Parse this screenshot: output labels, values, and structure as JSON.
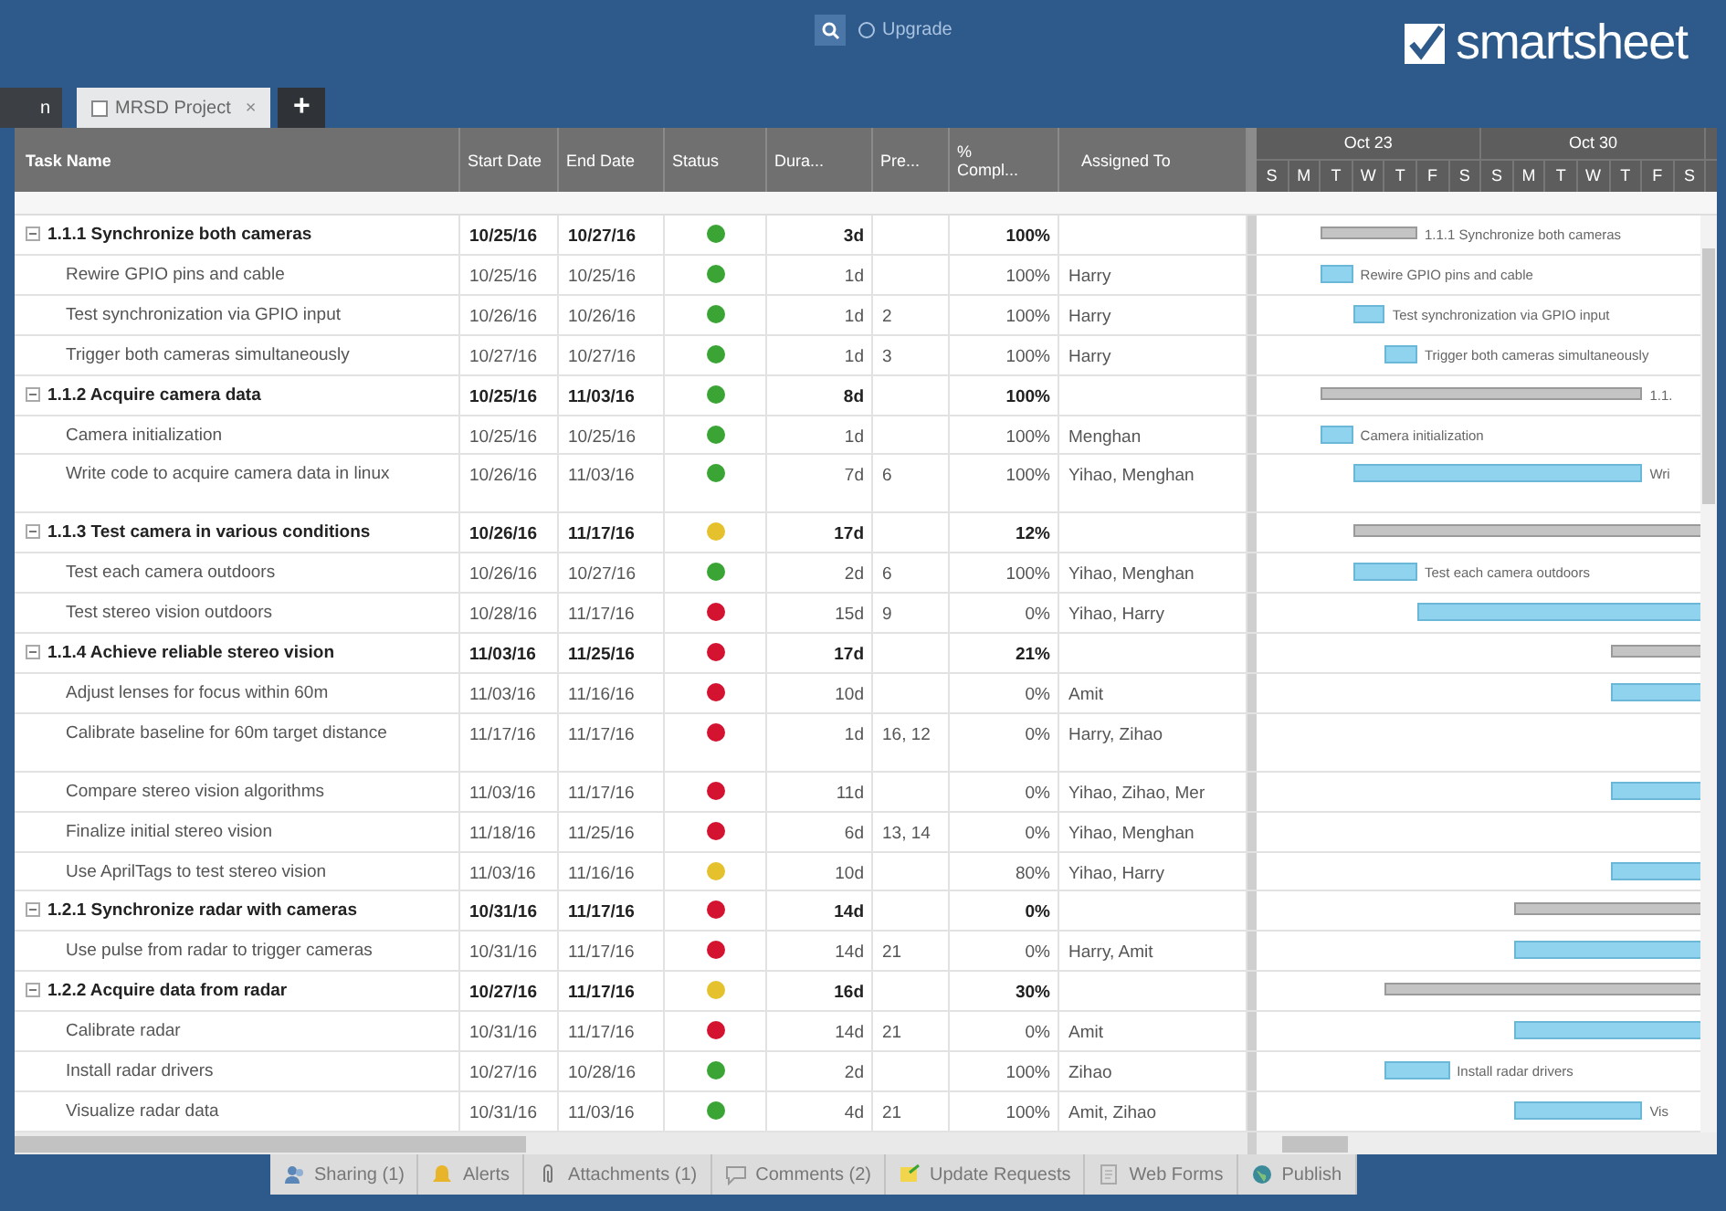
{
  "top_bar": {
    "upgrade": "Upgrade",
    "logo": "smartsheet"
  },
  "tabs": [
    {
      "label": "n",
      "selected": false
    },
    {
      "label": "MRSD Project",
      "selected": true,
      "close": "×"
    }
  ],
  "add_tab": "+",
  "columns": [
    "Task Name",
    "Start Date",
    "End Date",
    "Status",
    "Dura...",
    "Pre...",
    "% Compl...",
    "Assigned To"
  ],
  "gantt_header": {
    "weeks": [
      "Oct 23",
      "Oct 30"
    ],
    "days": [
      "S",
      "M",
      "T",
      "W",
      "T",
      "F",
      "S",
      "S",
      "M",
      "T",
      "W",
      "T",
      "F",
      "S"
    ]
  },
  "rows": [
    {
      "kind": "summary",
      "expanded": true,
      "name": "1.1.1 Synchronize both cameras",
      "start": "10/25/16",
      "end": "10/27/16",
      "color": "#3aa535",
      "duration": "3d",
      "pred": "",
      "complete": "100%",
      "assigned": "",
      "bar_label": "1.1.1 Synchronize both cameras"
    },
    {
      "kind": "task",
      "name": "Rewire GPIO pins and cable",
      "start": "10/25/16",
      "end": "10/25/16",
      "color": "#3aa535",
      "duration": "1d",
      "pred": "",
      "complete": "100%",
      "assigned": "Harry",
      "bar_label": "Rewire GPIO pins and cable"
    },
    {
      "kind": "task",
      "name": "Test synchronization via GPIO input",
      "start": "10/26/16",
      "end": "10/26/16",
      "color": "#3aa535",
      "duration": "1d",
      "pred": "2",
      "complete": "100%",
      "assigned": "Harry",
      "bar_label": "Test synchronization via GPIO input"
    },
    {
      "kind": "task",
      "name": "Trigger both cameras simultaneously",
      "start": "10/27/16",
      "end": "10/27/16",
      "color": "#3aa535",
      "duration": "1d",
      "pred": "3",
      "complete": "100%",
      "assigned": "Harry",
      "bar_label": "Trigger both cameras simultaneously"
    },
    {
      "kind": "summary",
      "expanded": true,
      "name": "1.1.2 Acquire camera data",
      "start": "10/25/16",
      "end": "11/03/16",
      "color": "#3aa535",
      "duration": "8d",
      "pred": "",
      "complete": "100%",
      "assigned": "",
      "bar_label": "1.1."
    },
    {
      "kind": "task",
      "name": "Camera initialization",
      "start": "10/25/16",
      "end": "10/25/16",
      "color": "#3aa535",
      "duration": "1d",
      "pred": "",
      "complete": "100%",
      "assigned": "Menghan",
      "bar_label": "Camera initialization"
    },
    {
      "kind": "task",
      "name": "Write code to acquire camera data in linux",
      "start": "10/26/16",
      "end": "11/03/16",
      "color": "#3aa535",
      "duration": "7d",
      "pred": "6",
      "complete": "100%",
      "assigned": "Yihao, Menghan",
      "bar_label": "Wri"
    },
    {
      "kind": "summary",
      "expanded": true,
      "name": "1.1.3 Test camera in various conditions",
      "start": "10/26/16",
      "end": "11/17/16",
      "color": "#e5c12e",
      "duration": "17d",
      "pred": "",
      "complete": "12%",
      "assigned": ""
    },
    {
      "kind": "task",
      "name": "Test each camera outdoors",
      "start": "10/26/16",
      "end": "10/27/16",
      "color": "#3aa535",
      "duration": "2d",
      "pred": "6",
      "complete": "100%",
      "assigned": "Yihao, Menghan",
      "bar_label": "Test each camera outdoors"
    },
    {
      "kind": "task",
      "name": "Test stereo vision outdoors",
      "start": "10/28/16",
      "end": "11/17/16",
      "color": "#d3132f",
      "duration": "15d",
      "pred": "9",
      "complete": "0%",
      "assigned": "Yihao, Harry"
    },
    {
      "kind": "summary",
      "expanded": true,
      "name": "1.1.4 Achieve reliable stereo vision",
      "start": "11/03/16",
      "end": "11/25/16",
      "color": "#d3132f",
      "duration": "17d",
      "pred": "",
      "complete": "21%",
      "assigned": ""
    },
    {
      "kind": "task",
      "name": "Adjust lenses for focus within 60m",
      "start": "11/03/16",
      "end": "11/16/16",
      "color": "#d3132f",
      "duration": "10d",
      "pred": "",
      "complete": "0%",
      "assigned": "Amit"
    },
    {
      "kind": "task",
      "name": "Calibrate baseline for 60m target distance",
      "start": "11/17/16",
      "end": "11/17/16",
      "color": "#d3132f",
      "duration": "1d",
      "pred": "16, 12",
      "complete": "0%",
      "assigned": "Harry, Zihao"
    },
    {
      "kind": "task",
      "name": "Compare stereo vision algorithms",
      "start": "11/03/16",
      "end": "11/17/16",
      "color": "#d3132f",
      "duration": "11d",
      "pred": "",
      "complete": "0%",
      "assigned": "Yihao, Zihao, Mer"
    },
    {
      "kind": "task",
      "name": "Finalize initial stereo vision",
      "start": "11/18/16",
      "end": "11/25/16",
      "color": "#d3132f",
      "duration": "6d",
      "pred": "13, 14",
      "complete": "0%",
      "assigned": "Yihao, Menghan"
    },
    {
      "kind": "task",
      "name": "Use AprilTags to test stereo vision",
      "start": "11/03/16",
      "end": "11/16/16",
      "color": "#e5c12e",
      "duration": "10d",
      "pred": "",
      "complete": "80%",
      "assigned": "Yihao, Harry"
    },
    {
      "kind": "summary",
      "expanded": true,
      "name": "1.2.1 Synchronize radar with cameras",
      "start": "10/31/16",
      "end": "11/17/16",
      "color": "#d3132f",
      "duration": "14d",
      "pred": "",
      "complete": "0%",
      "assigned": ""
    },
    {
      "kind": "task",
      "name": "Use pulse from radar to trigger cameras",
      "start": "10/31/16",
      "end": "11/17/16",
      "color": "#d3132f",
      "duration": "14d",
      "pred": "21",
      "complete": "0%",
      "assigned": "Harry, Amit"
    },
    {
      "kind": "summary",
      "expanded": true,
      "name": "1.2.2 Acquire data from radar",
      "start": "10/27/16",
      "end": "11/17/16",
      "color": "#e5c12e",
      "duration": "16d",
      "pred": "",
      "complete": "30%",
      "assigned": ""
    },
    {
      "kind": "task",
      "name": "Calibrate radar",
      "start": "10/31/16",
      "end": "11/17/16",
      "color": "#d3132f",
      "duration": "14d",
      "pred": "21",
      "complete": "0%",
      "assigned": "Amit"
    },
    {
      "kind": "task",
      "name": "Install radar drivers",
      "start": "10/27/16",
      "end": "10/28/16",
      "color": "#3aa535",
      "duration": "2d",
      "pred": "",
      "complete": "100%",
      "assigned": "Zihao",
      "bar_label": "Install radar drivers"
    },
    {
      "kind": "task",
      "name": "Visualize radar data",
      "start": "10/31/16",
      "end": "11/03/16",
      "color": "#3aa535",
      "duration": "4d",
      "pred": "21",
      "complete": "100%",
      "assigned": "Amit, Zihao",
      "bar_label": "Vis"
    }
  ],
  "footer_tabs": [
    {
      "kind": "sharing",
      "label": "Sharing (1)"
    },
    {
      "kind": "alerts",
      "label": "Alerts"
    },
    {
      "kind": "attachments",
      "label": "Attachments (1)"
    },
    {
      "kind": "comments",
      "label": "Comments (2)"
    },
    {
      "kind": "requests",
      "label": "Update Requests"
    },
    {
      "kind": "forms",
      "label": "Web Forms"
    },
    {
      "kind": "publish",
      "label": "Publish"
    }
  ]
}
